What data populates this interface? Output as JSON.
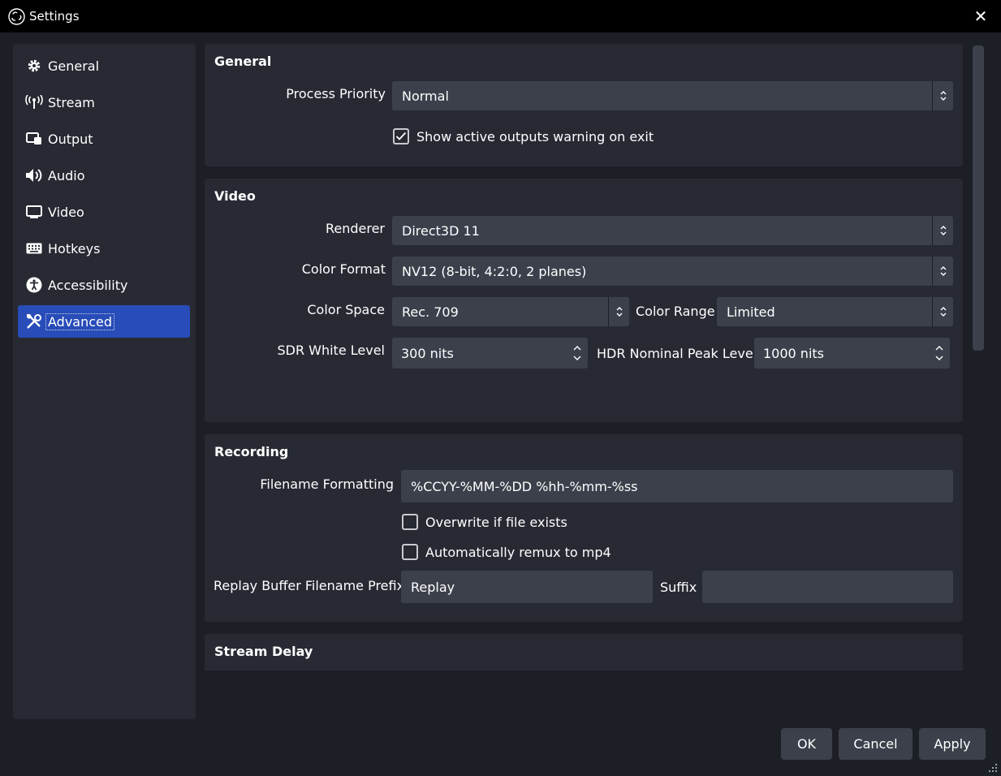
{
  "window": {
    "title": "Settings",
    "app_icon": "obs-logo-icon",
    "close_icon": "close-icon"
  },
  "colors": {
    "accent": "#284cb8",
    "background": "#1d1f27",
    "panel": "#272a33",
    "control": "#3c404b"
  },
  "sidebar": {
    "items": [
      {
        "label": "General",
        "icon": "gear-icon"
      },
      {
        "label": "Stream",
        "icon": "broadcast-icon"
      },
      {
        "label": "Output",
        "icon": "output-icon"
      },
      {
        "label": "Audio",
        "icon": "speaker-icon"
      },
      {
        "label": "Video",
        "icon": "monitor-icon"
      },
      {
        "label": "Hotkeys",
        "icon": "keyboard-icon"
      },
      {
        "label": "Accessibility",
        "icon": "accessibility-icon"
      },
      {
        "label": "Advanced",
        "icon": "tools-icon",
        "selected": true
      }
    ]
  },
  "general": {
    "title": "General",
    "process_priority_label": "Process Priority",
    "process_priority_value": "Normal",
    "show_warning_label": "Show active outputs warning on exit",
    "show_warning_checked": true
  },
  "video": {
    "title": "Video",
    "renderer_label": "Renderer",
    "renderer_value": "Direct3D 11",
    "color_format_label": "Color Format",
    "color_format_value": "NV12 (8-bit, 4:2:0, 2 planes)",
    "color_space_label": "Color Space",
    "color_space_value": "Rec. 709",
    "color_range_label": "Color Range",
    "color_range_value": "Limited",
    "sdr_white_label": "SDR White Level",
    "sdr_white_value": "300 nits",
    "hdr_peak_label": "HDR Nominal Peak Level",
    "hdr_peak_value": "1000 nits"
  },
  "recording": {
    "title": "Recording",
    "filename_formatting_label": "Filename Formatting",
    "filename_formatting_value": "%CCYY-%MM-%DD %hh-%mm-%ss",
    "overwrite_label": "Overwrite if file exists",
    "overwrite_checked": false,
    "remux_label": "Automatically remux to mp4",
    "remux_checked": false,
    "replay_prefix_label": "Replay Buffer Filename Prefix",
    "replay_prefix_value": "Replay",
    "suffix_label": "Suffix",
    "suffix_value": ""
  },
  "stream_delay": {
    "title": "Stream Delay"
  },
  "buttons": {
    "ok": "OK",
    "cancel": "Cancel",
    "apply": "Apply"
  }
}
